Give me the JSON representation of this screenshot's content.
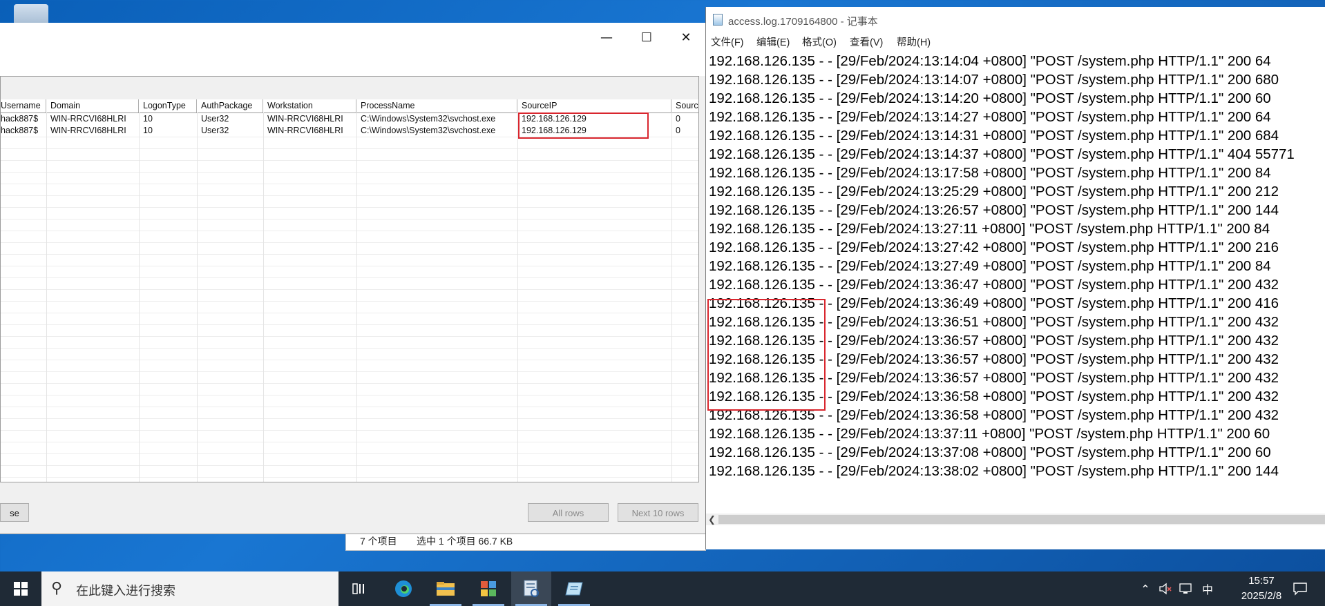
{
  "explorer": {
    "item_count": "7 个项目",
    "selected": "选中 1 个项目  66.7 KB"
  },
  "log_parser": {
    "columns": [
      "Username",
      "Domain",
      "LogonType",
      "AuthPackage",
      "Workstation",
      "ProcessName",
      "SourceIP",
      "Sourc"
    ],
    "rows": [
      [
        "hack887$",
        "WIN-RRCVI68HLRI",
        "10",
        "User32",
        "WIN-RRCVI68HLRI",
        "C:\\Windows\\System32\\svchost.exe",
        "192.168.126.129",
        "0"
      ],
      [
        "hack887$",
        "WIN-RRCVI68HLRI",
        "10",
        "User32",
        "WIN-RRCVI68HLRI",
        "C:\\Windows\\System32\\svchost.exe",
        "192.168.126.129",
        "0"
      ]
    ],
    "close_button_label": "se",
    "all_rows_label": "All rows",
    "next_rows_label": "Next 10 rows"
  },
  "notepad": {
    "title": "access.log.1709164800 - 记事本",
    "menu": [
      "文件(F)",
      "编辑(E)",
      "格式(O)",
      "查看(V)",
      "帮助(H)"
    ],
    "lines": [
      "192.168.126.135 - - [29/Feb/2024:13:14:04 +0800] \"POST /system.php HTTP/1.1\" 200 64",
      "192.168.126.135 - - [29/Feb/2024:13:14:07 +0800] \"POST /system.php HTTP/1.1\" 200 680",
      "192.168.126.135 - - [29/Feb/2024:13:14:20 +0800] \"POST /system.php HTTP/1.1\" 200 60",
      "192.168.126.135 - - [29/Feb/2024:13:14:27 +0800] \"POST /system.php HTTP/1.1\" 200 64",
      "192.168.126.135 - - [29/Feb/2024:13:14:31 +0800] \"POST /system.php HTTP/1.1\" 200 684",
      "192.168.126.135 - - [29/Feb/2024:13:14:37 +0800] \"POST /system.php HTTP/1.1\" 404 55771",
      "192.168.126.135 - - [29/Feb/2024:13:17:58 +0800] \"POST /system.php HTTP/1.1\" 200 84",
      "192.168.126.135 - - [29/Feb/2024:13:25:29 +0800] \"POST /system.php HTTP/1.1\" 200 212",
      "192.168.126.135 - - [29/Feb/2024:13:26:57 +0800] \"POST /system.php HTTP/1.1\" 200 144",
      "192.168.126.135 - - [29/Feb/2024:13:27:11 +0800] \"POST /system.php HTTP/1.1\" 200 84",
      "192.168.126.135 - - [29/Feb/2024:13:27:42 +0800] \"POST /system.php HTTP/1.1\" 200 216",
      "192.168.126.135 - - [29/Feb/2024:13:27:49 +0800] \"POST /system.php HTTP/1.1\" 200 84",
      "192.168.126.135 - - [29/Feb/2024:13:36:47 +0800] \"POST /system.php HTTP/1.1\" 200 432",
      "192.168.126.135 - - [29/Feb/2024:13:36:49 +0800] \"POST /system.php HTTP/1.1\" 200 416",
      "192.168.126.135 - - [29/Feb/2024:13:36:51 +0800] \"POST /system.php HTTP/1.1\" 200 432",
      "192.168.126.135 - - [29/Feb/2024:13:36:57 +0800] \"POST /system.php HTTP/1.1\" 200 432",
      "192.168.126.135 - - [29/Feb/2024:13:36:57 +0800] \"POST /system.php HTTP/1.1\" 200 432",
      "192.168.126.135 - - [29/Feb/2024:13:36:57 +0800] \"POST /system.php HTTP/1.1\" 200 432",
      "192.168.126.135 - - [29/Feb/2024:13:36:58 +0800] \"POST /system.php HTTP/1.1\" 200 432",
      "192.168.126.135 - - [29/Feb/2024:13:36:58 +0800] \"POST /system.php HTTP/1.1\" 200 432",
      "192.168.126.135 - - [29/Feb/2024:13:37:11 +0800] \"POST /system.php HTTP/1.1\" 200 60",
      "192.168.126.135 - - [29/Feb/2024:13:37:08 +0800] \"POST /system.php HTTP/1.1\" 200 60",
      "192.168.126.135 - - [29/Feb/2024:13:38:02 +0800] \"POST /system.php HTTP/1.1\" 200 144"
    ]
  },
  "taskbar": {
    "search_placeholder": "在此键入进行搜索",
    "ime_label": "中",
    "time": "15:57",
    "date": "2025/2/8",
    "icons": [
      "task-view-icon",
      "edge-icon",
      "file-explorer-icon",
      "control-panel-icon",
      "log-viewer-icon",
      "notepad-icon"
    ]
  }
}
